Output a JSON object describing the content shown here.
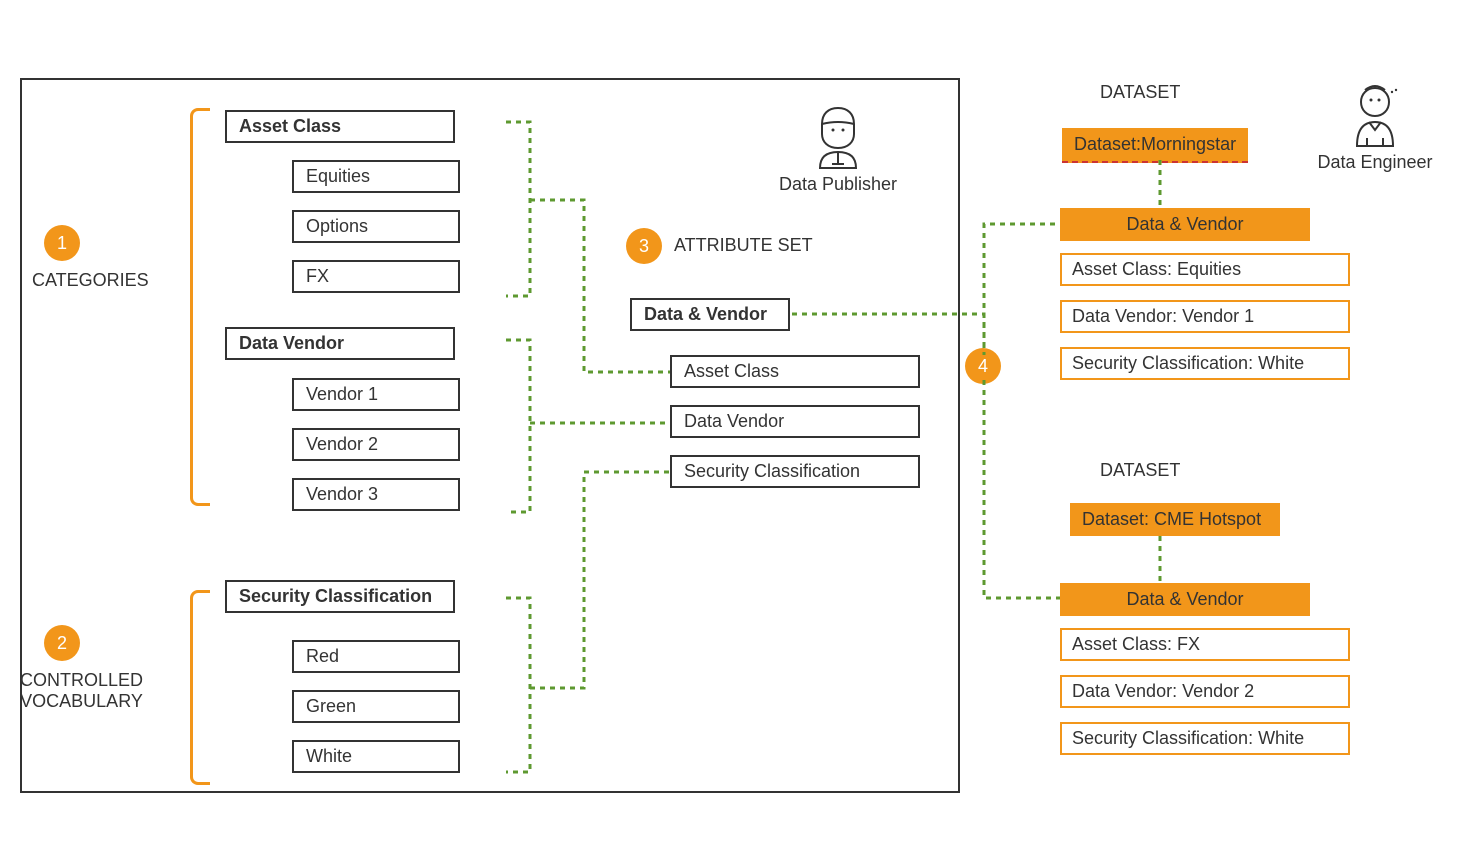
{
  "sections": {
    "categories": {
      "num": "1",
      "label": "CATEGORIES"
    },
    "controlled": {
      "num": "2",
      "label": "CONTROLLED\nVOCABULARY"
    },
    "attribute": {
      "num": "3",
      "label": "ATTRIBUTE SET"
    },
    "dataset_link": {
      "num": "4"
    }
  },
  "cat1": {
    "title": "Asset Class",
    "items": [
      "Equities",
      "Options",
      "FX"
    ]
  },
  "cat2": {
    "title": "Data Vendor",
    "items": [
      "Vendor 1",
      "Vendor 2",
      "Vendor 3"
    ]
  },
  "controlled": {
    "title": "Security Classification",
    "items": [
      "Red",
      "Green",
      "White"
    ]
  },
  "attr_set": {
    "title": "Data & Vendor",
    "items": [
      "Asset Class",
      "Data Vendor",
      "Security Classification"
    ]
  },
  "personas": {
    "publisher": "Data Publisher",
    "engineer": "Data Engineer"
  },
  "ds1": {
    "head": "DATASET",
    "name": "Dataset:Morningstar",
    "group": "Data & Vendor",
    "kv": [
      "Asset Class: Equities",
      "Data Vendor: Vendor 1",
      "Security Classification: White"
    ]
  },
  "ds2": {
    "head": "DATASET",
    "name": "Dataset: CME Hotspot",
    "group": "Data & Vendor",
    "kv": [
      "Asset Class: FX",
      "Data Vendor: Vendor 2",
      "Security Classification: White"
    ]
  }
}
